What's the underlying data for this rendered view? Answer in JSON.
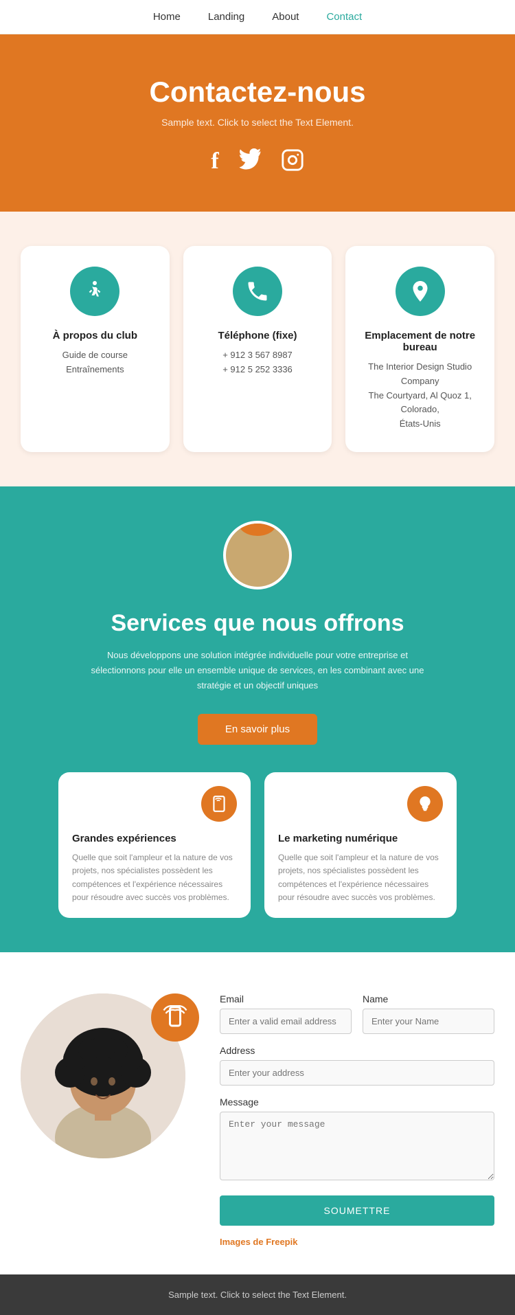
{
  "nav": {
    "items": [
      {
        "label": "Home",
        "active": false
      },
      {
        "label": "Landing",
        "active": false
      },
      {
        "label": "About",
        "active": false
      },
      {
        "label": "Contact",
        "active": true
      }
    ]
  },
  "hero": {
    "title": "Contactez-nous",
    "subtitle": "Sample text. Click to select the Text Element.",
    "social": {
      "facebook": "f",
      "twitter": "🐦",
      "instagram": "📷"
    }
  },
  "info_cards": [
    {
      "icon": "🏃",
      "title": "À propos du club",
      "line1": "Guide de course",
      "line2": "Entraînements"
    },
    {
      "icon": "📞",
      "title": "Téléphone (fixe)",
      "line1": "+ 912 3 567 8987",
      "line2": "+ 912 5 252 3336"
    },
    {
      "icon": "📍",
      "title": "Emplacement de notre bureau",
      "line1": "The Interior Design Studio Company",
      "line2": "The Courtyard, Al Quoz 1, Colorado,",
      "line3": "États-Unis"
    }
  ],
  "services": {
    "title": "Services que nous offrons",
    "description": "Nous développons une solution intégrée individuelle pour votre entreprise et sélectionnons pour elle un ensemble unique de services, en les combinant avec une stratégie et un objectif uniques",
    "button_label": "En savoir plus",
    "cards": [
      {
        "icon": "📱",
        "title": "Grandes expériences",
        "text": "Quelle que soit l'ampleur et la nature de vos projets, nos spécialistes possèdent les compétences et l'expérience nécessaires pour résoudre avec succès vos problèmes."
      },
      {
        "icon": "💡",
        "title": "Le marketing numérique",
        "text": "Quelle que soit l'ampleur et la nature de vos projets, nos spécialistes possèdent les compétences et l'expérience nécessaires pour résoudre avec succès vos problèmes."
      }
    ]
  },
  "contact_form": {
    "email_label": "Email",
    "email_placeholder": "Enter a valid email address",
    "name_label": "Name",
    "name_placeholder": "Enter your Name",
    "address_label": "Address",
    "address_placeholder": "Enter your address",
    "message_label": "Message",
    "message_placeholder": "Enter your message",
    "submit_label": "SOUMETTRE",
    "freepik_text": "Images de",
    "freepik_brand": "Freepik"
  },
  "footer": {
    "text": "Sample text. Click to select the Text Element."
  }
}
